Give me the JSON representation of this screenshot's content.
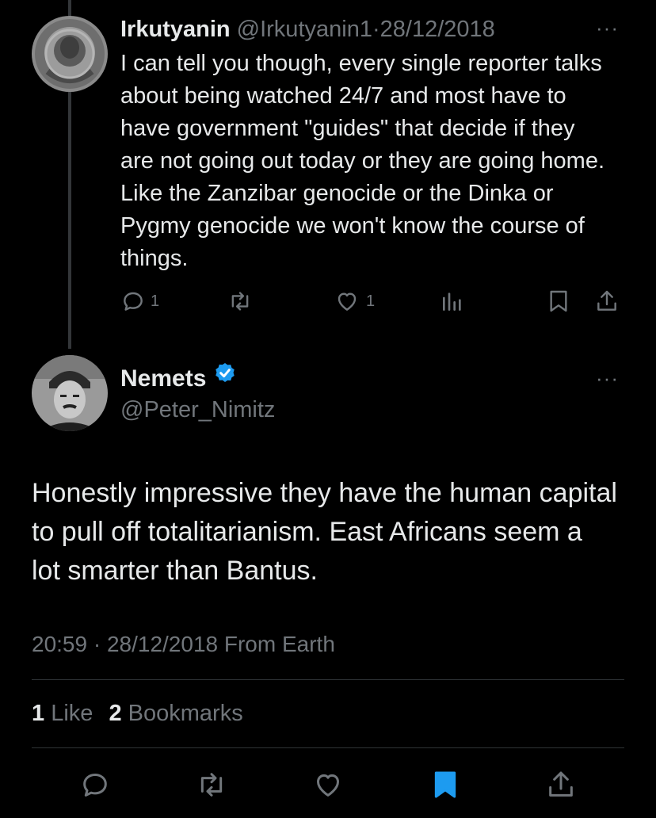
{
  "reply": {
    "display_name": "Irkutyanin",
    "handle": "@Irkutyanin1",
    "separator": "·",
    "date": "28/12/2018",
    "text": "I can tell you though, every single reporter talks about being watched 24/7 and most have to have government \"guides\" that decide if they are not going out today or they are going home. Like the Zanzibar genocide or the Dinka or Pygmy genocide we won't know the course of things.",
    "reply_count": "1",
    "like_count": "1",
    "more_label": "···"
  },
  "main": {
    "display_name": "Nemets",
    "handle": "@Peter_Nimitz",
    "text": "Honestly impressive they have the human capital to pull off totalitarianism. East Africans seem a lot smarter than Bantus.",
    "meta": "20:59 · 28/12/2018 From Earth",
    "likes_count": "1",
    "likes_label": "Like",
    "bookmarks_count": "2",
    "bookmarks_label": "Bookmarks",
    "more_label": "···"
  },
  "icons": {
    "reply": "reply-icon",
    "repost": "repost-icon",
    "like": "heart-icon",
    "views": "views-icon",
    "bookmark": "bookmark-icon",
    "share": "share-icon",
    "verified": "verified-badge-icon"
  },
  "colors": {
    "background": "#000000",
    "text": "#e7e9ea",
    "muted": "#71767b",
    "accent": "#1d9bf0"
  }
}
